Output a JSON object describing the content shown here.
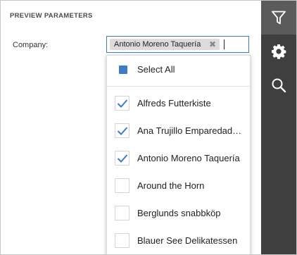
{
  "panel": {
    "title": "PREVIEW PARAMETERS"
  },
  "parameter": {
    "label": "Company:",
    "selected_tag": "Antonio Moreno Taquería",
    "tag_remove_icon": "✖"
  },
  "dropdown": {
    "select_all_label": "Select All",
    "select_all_state": "indeterminate",
    "items": [
      {
        "label": "Alfreds Futterkiste",
        "checked": true
      },
      {
        "label": "Ana Trujillo Emparedados y helados",
        "checked": true
      },
      {
        "label": "Antonio Moreno Taquería",
        "checked": true
      },
      {
        "label": "Around the Horn",
        "checked": false
      },
      {
        "label": "Berglunds snabbköp",
        "checked": false
      },
      {
        "label": "Blauer See Delikatessen",
        "checked": false
      }
    ]
  },
  "sidebar": {
    "buttons": [
      {
        "icon": "filter-icon",
        "active": true
      },
      {
        "icon": "gear-icon",
        "active": false
      },
      {
        "icon": "search-icon",
        "active": false
      }
    ]
  },
  "colors": {
    "accent": "#3c7cc9",
    "sidebar_bg": "#3f3f3f",
    "sidebar_active": "#5b5b5b",
    "tag_bg": "#dcdcdc"
  }
}
